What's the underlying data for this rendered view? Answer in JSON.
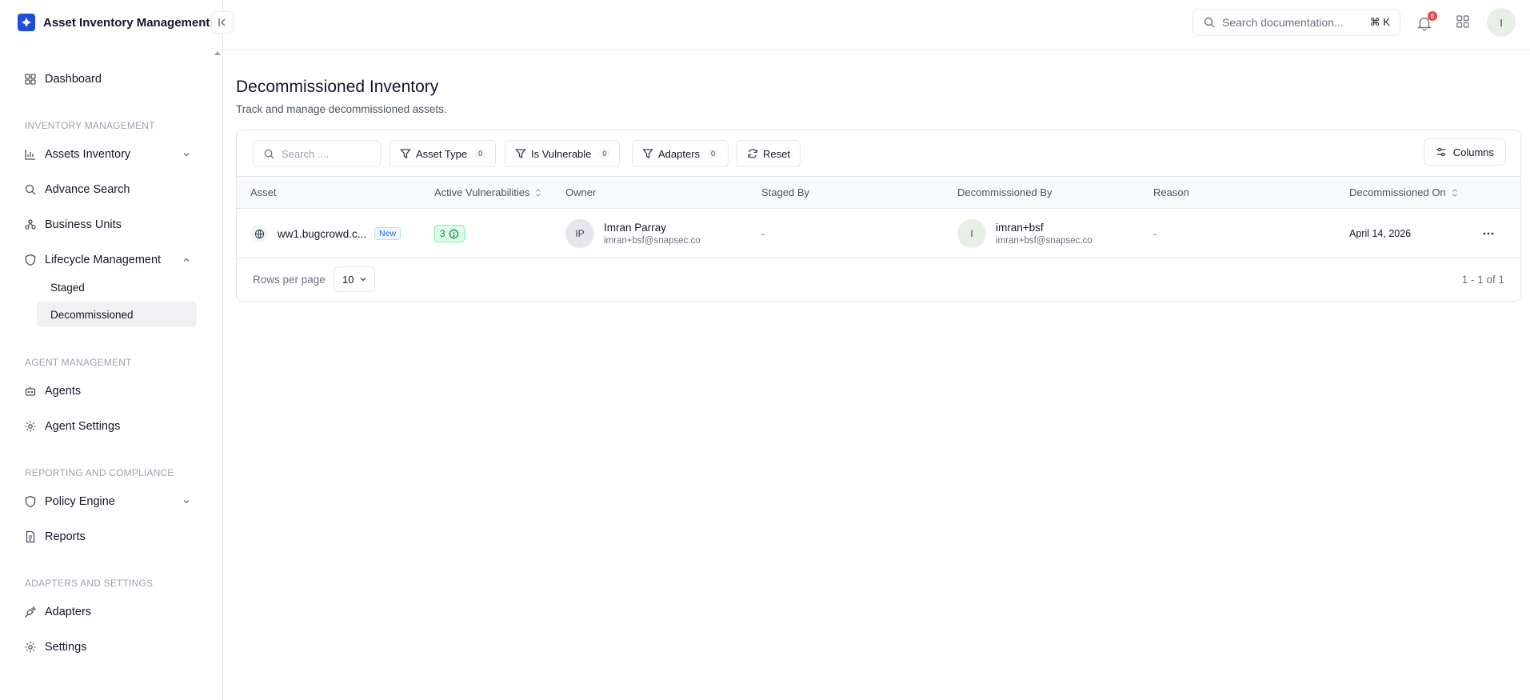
{
  "app": {
    "title": "Asset Inventory Management",
    "accent": "#1d4ed8"
  },
  "sidebar": {
    "dashboard": "Dashboard",
    "sections": {
      "inventory": "INVENTORY MANAGEMENT",
      "agent": "AGENT MANAGEMENT",
      "reporting": "REPORTING AND COMPLIANCE",
      "adapters": "ADAPTERS AND SETTINGS"
    },
    "items": {
      "assets_inventory": "Assets Inventory",
      "advance_search": "Advance Search",
      "business_units": "Business Units",
      "lifecycle": "Lifecycle Management",
      "staged": "Staged",
      "decommissioned": "Decommissioned",
      "agents": "Agents",
      "agent_settings": "Agent Settings",
      "policy_engine": "Policy Engine",
      "reports": "Reports",
      "adapters": "Adapters",
      "settings": "Settings"
    },
    "active_item": "Decommissioned"
  },
  "header": {
    "search_placeholder": "Search documentation...",
    "shortcut": "⌘ K",
    "notification_count": "6",
    "user_initial": "I"
  },
  "page": {
    "title": "Decommissioned Inventory",
    "subtitle": "Track and manage decommissioned assets."
  },
  "toolbar": {
    "search_placeholder": "Search ....",
    "filters": [
      {
        "label": "Asset Type",
        "count": "0"
      },
      {
        "label": "Is Vulnerable",
        "count": "0"
      },
      {
        "label": "Adapters",
        "count": "0"
      }
    ],
    "reset_label": "Reset",
    "columns_label": "Columns"
  },
  "table": {
    "columns": [
      "Asset",
      "Active Vulnerabilities",
      "Owner",
      "Staged By",
      "Decommissioned By",
      "Reason",
      "Decommissioned On"
    ],
    "rows": [
      {
        "asset": "ww1.bugcrowd.c...",
        "badge": "New",
        "vulnerabilities": "3",
        "owner_initials": "IP",
        "owner_name": "Imran Parray",
        "owner_email": "imran+bsf@snapsec.co",
        "staged_by": "-",
        "decom_initial": "I",
        "decom_name": "imran+bsf",
        "decom_email": "imran+bsf@snapsec.co",
        "reason": "-",
        "decommissioned_on": "April 14, 2026"
      }
    ]
  },
  "footer": {
    "rows_per_page_label": "Rows per page",
    "rows_per_page_value": "10",
    "pagination": "1 - 1 of 1"
  }
}
